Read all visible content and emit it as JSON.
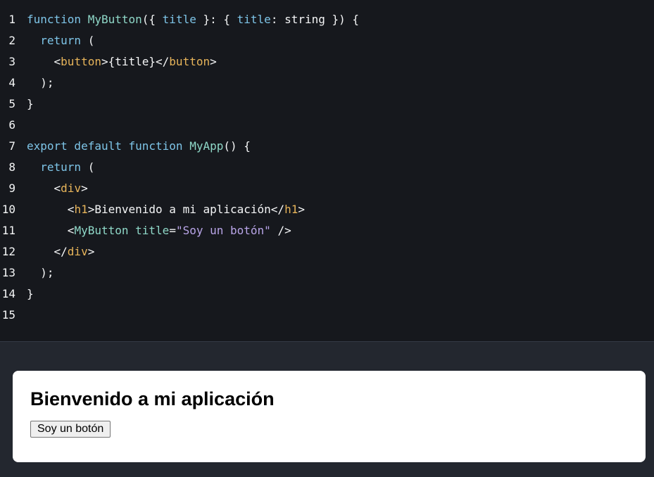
{
  "editor": {
    "lines": [
      {
        "num": "1",
        "segs": [
          {
            "t": "function ",
            "c": "kw"
          },
          {
            "t": "MyButton",
            "c": "fn"
          },
          {
            "t": "({ ",
            "c": "pun"
          },
          {
            "t": "title",
            "c": "prm"
          },
          {
            "t": " }: { ",
            "c": "pun"
          },
          {
            "t": "title",
            "c": "prm"
          },
          {
            "t": ": string }) {",
            "c": "pun"
          }
        ]
      },
      {
        "num": "2",
        "segs": [
          {
            "t": "  ",
            "c": "pun"
          },
          {
            "t": "return",
            "c": "kw"
          },
          {
            "t": " (",
            "c": "pun"
          }
        ]
      },
      {
        "num": "3",
        "segs": [
          {
            "t": "    <",
            "c": "pun"
          },
          {
            "t": "button",
            "c": "tag"
          },
          {
            "t": ">{title}</",
            "c": "pun"
          },
          {
            "t": "button",
            "c": "tag"
          },
          {
            "t": ">",
            "c": "pun"
          }
        ]
      },
      {
        "num": "4",
        "segs": [
          {
            "t": "  );",
            "c": "pun"
          }
        ]
      },
      {
        "num": "5",
        "segs": [
          {
            "t": "}",
            "c": "pun"
          }
        ]
      },
      {
        "num": "6",
        "segs": []
      },
      {
        "num": "7",
        "segs": [
          {
            "t": "export default function ",
            "c": "kw"
          },
          {
            "t": "MyApp",
            "c": "fn"
          },
          {
            "t": "() {",
            "c": "pun"
          }
        ]
      },
      {
        "num": "8",
        "segs": [
          {
            "t": "  ",
            "c": "pun"
          },
          {
            "t": "return",
            "c": "kw"
          },
          {
            "t": " (",
            "c": "pun"
          }
        ]
      },
      {
        "num": "9",
        "segs": [
          {
            "t": "    <",
            "c": "pun"
          },
          {
            "t": "div",
            "c": "tag"
          },
          {
            "t": ">",
            "c": "pun"
          }
        ]
      },
      {
        "num": "10",
        "segs": [
          {
            "t": "      <",
            "c": "pun"
          },
          {
            "t": "h1",
            "c": "tag"
          },
          {
            "t": ">Bienvenido a mi aplicación</",
            "c": "pun"
          },
          {
            "t": "h1",
            "c": "tag"
          },
          {
            "t": ">",
            "c": "pun"
          }
        ]
      },
      {
        "num": "11",
        "segs": [
          {
            "t": "      <",
            "c": "pun"
          },
          {
            "t": "MyButton",
            "c": "cmp"
          },
          {
            "t": " ",
            "c": "pun"
          },
          {
            "t": "title",
            "c": "attr"
          },
          {
            "t": "=",
            "c": "pun"
          },
          {
            "t": "\"Soy un botón\"",
            "c": "str"
          },
          {
            "t": " />",
            "c": "pun"
          }
        ]
      },
      {
        "num": "12",
        "segs": [
          {
            "t": "    </",
            "c": "pun"
          },
          {
            "t": "div",
            "c": "tag"
          },
          {
            "t": ">",
            "c": "pun"
          }
        ]
      },
      {
        "num": "13",
        "segs": [
          {
            "t": "  );",
            "c": "pun"
          }
        ]
      },
      {
        "num": "14",
        "segs": [
          {
            "t": "}",
            "c": "pun"
          }
        ]
      },
      {
        "num": "15",
        "segs": []
      }
    ]
  },
  "preview": {
    "heading": "Bienvenido a mi aplicación",
    "button_label": "Soy un botón"
  },
  "colors": {
    "editor_bg": "#16181d",
    "page_bg": "#23272f",
    "keyword": "#7ec5e8",
    "function_name": "#8fd8c8",
    "tag": "#e7b45a",
    "string": "#b9a5e8"
  }
}
